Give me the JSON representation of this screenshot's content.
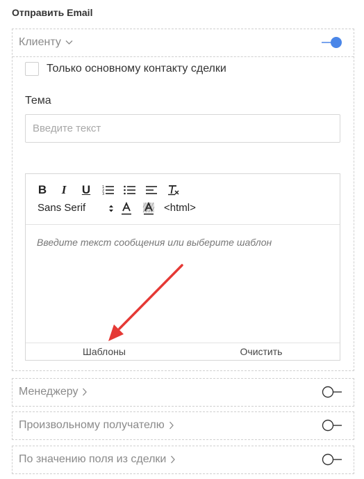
{
  "title": "Отправить Email",
  "client_section": {
    "label": "Клиенту",
    "toggle_on": true,
    "checkbox_label": "Только основному контакту сделки",
    "checkbox_checked": false,
    "subject_label": "Тема",
    "subject_placeholder": "Введите текст",
    "subject_value": "",
    "editor": {
      "font_name": "Sans Serif",
      "html_label": "<html>",
      "placeholder": "Введите текст сообщения или выберите шаблон",
      "templates_label": "Шаблоны",
      "clear_label": "Очистить"
    }
  },
  "other_sections": {
    "manager": {
      "label": "Менеджеру",
      "toggle_on": false
    },
    "custom": {
      "label": "Произвольному получателю",
      "toggle_on": false
    },
    "field": {
      "label": "По значению поля из сделки",
      "toggle_on": false
    }
  },
  "colors": {
    "accent": "#4a86e8",
    "annotation_arrow": "#e53935"
  },
  "icons": {
    "bold": "bold-icon",
    "italic": "italic-icon",
    "underline": "underline-icon",
    "ordered_list": "ordered-list-icon",
    "bullet_list": "bullet-list-icon",
    "align": "align-icon",
    "clear_format": "clear-format-icon",
    "text_color": "text-color-icon",
    "background_color": "background-color-icon"
  }
}
